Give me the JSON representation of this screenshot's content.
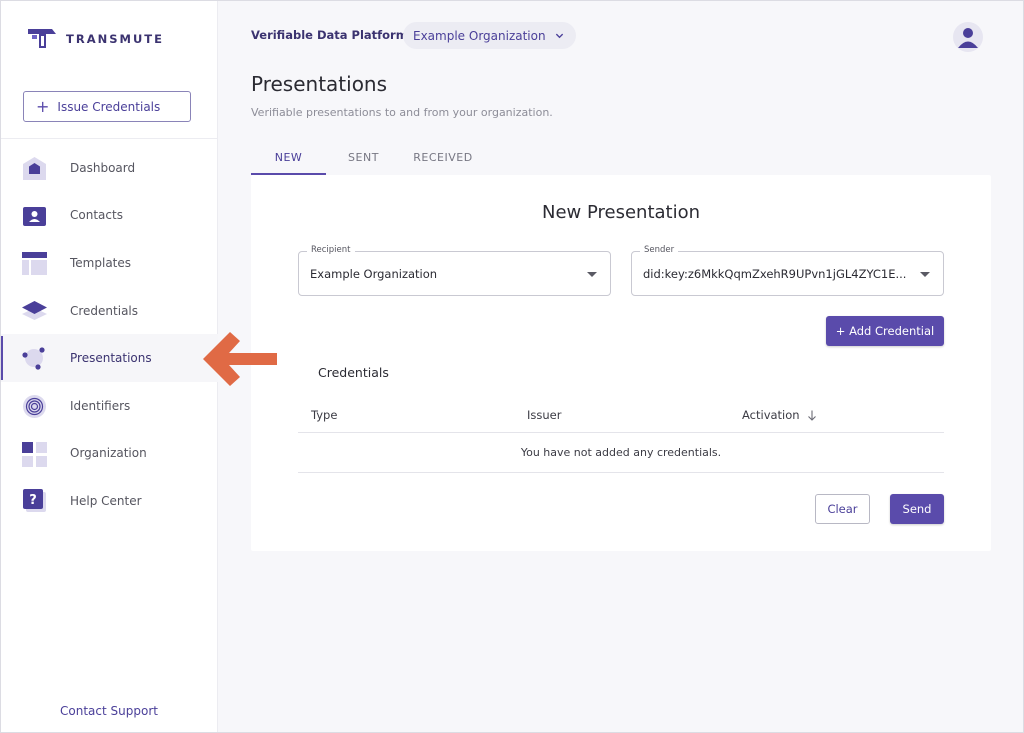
{
  "brand": {
    "name": "TRANSMUTE"
  },
  "sidebar": {
    "issue_button": "Issue Credentials",
    "items": [
      {
        "label": "Dashboard",
        "icon": "home-icon"
      },
      {
        "label": "Contacts",
        "icon": "contact-card-icon"
      },
      {
        "label": "Templates",
        "icon": "template-layout-icon"
      },
      {
        "label": "Credentials",
        "icon": "layers-icon"
      },
      {
        "label": "Presentations",
        "icon": "presentation-nodes-icon",
        "active": true
      },
      {
        "label": "Identifiers",
        "icon": "fingerprint-icon"
      },
      {
        "label": "Organization",
        "icon": "grid-icon"
      },
      {
        "label": "Help Center",
        "icon": "help-icon"
      }
    ],
    "contact_support": "Contact Support"
  },
  "header": {
    "platform": "Verifiable Data Platform",
    "org_selector": "Example Organization"
  },
  "page": {
    "title": "Presentations",
    "subtitle": "Verifiable presentations to and from your organization."
  },
  "tabs": [
    {
      "label": "NEW",
      "active": true
    },
    {
      "label": "SENT"
    },
    {
      "label": "RECEIVED"
    }
  ],
  "form": {
    "title": "New Presentation",
    "recipient": {
      "label": "Recipient",
      "value": "Example Organization"
    },
    "sender": {
      "label": "Sender",
      "value": "did:key:z6MkkQqmZxehR9UPvn1jGL4ZYC1E..."
    },
    "add_credential": "+ Add Credential",
    "credentials_heading": "Credentials",
    "table": {
      "columns": [
        "Type",
        "Issuer",
        "Activation"
      ],
      "empty_message": "You have not added any credentials."
    },
    "clear": "Clear",
    "send": "Send"
  },
  "colors": {
    "accent": "#5a4bab",
    "brand_dark": "#3b3370",
    "annotation_arrow": "#e06a45",
    "background": "#f7f7fa"
  }
}
